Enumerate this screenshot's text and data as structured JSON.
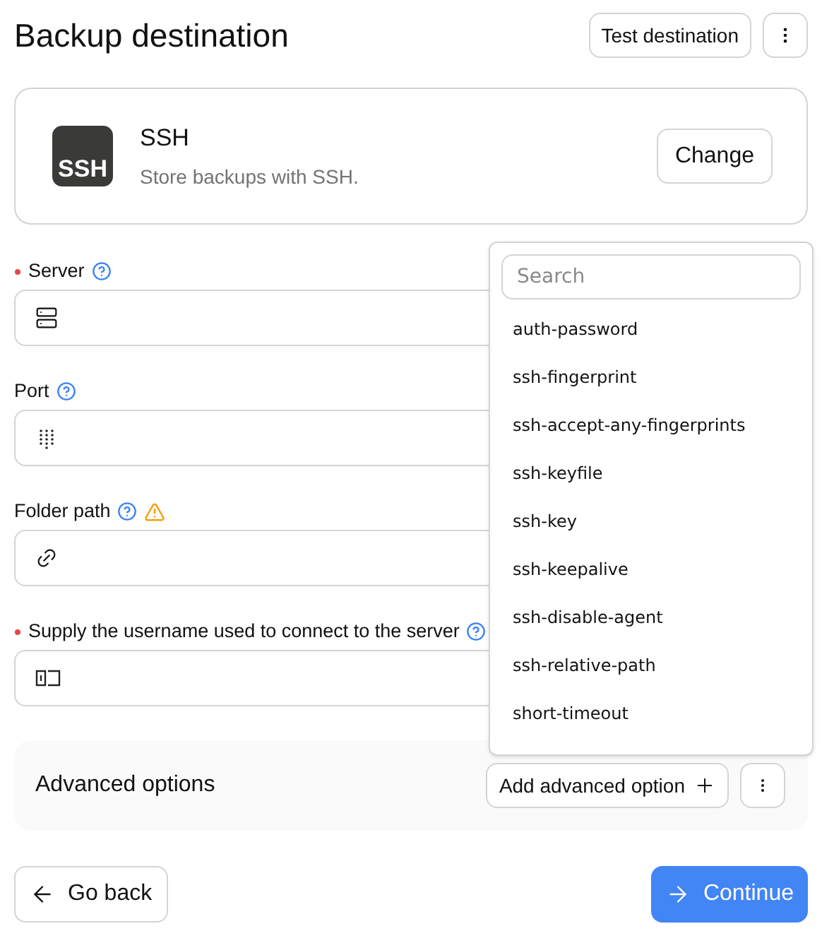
{
  "header": {
    "title": "Backup destination",
    "test_button": "Test destination"
  },
  "destination": {
    "logo": "SSH",
    "name": "SSH",
    "description": "Store backups with SSH.",
    "change_button": "Change"
  },
  "fields": [
    {
      "label": "Server",
      "required": true,
      "help": true,
      "warning": false,
      "kind": "server"
    },
    {
      "label": "Port",
      "required": false,
      "help": true,
      "warning": false,
      "kind": "port"
    },
    {
      "label": "Folder path",
      "required": false,
      "help": true,
      "warning": true,
      "kind": "path"
    },
    {
      "label": "Supply the username used to connect to the server",
      "required": true,
      "help": true,
      "warning": false,
      "kind": "username"
    }
  ],
  "advanced": {
    "title": "Advanced options",
    "add_button": "Add advanced option"
  },
  "dropdown": {
    "search": {
      "placeholder": "Search"
    },
    "items": [
      "auth-password",
      "ssh-fingerprint",
      "ssh-accept-any-fingerprints",
      "ssh-keyfile",
      "ssh-key",
      "ssh-keepalive",
      "ssh-disable-agent",
      "ssh-relative-path",
      "short-timeout"
    ]
  },
  "footer": {
    "back_button": "Go back",
    "continue_button": "Continue"
  }
}
